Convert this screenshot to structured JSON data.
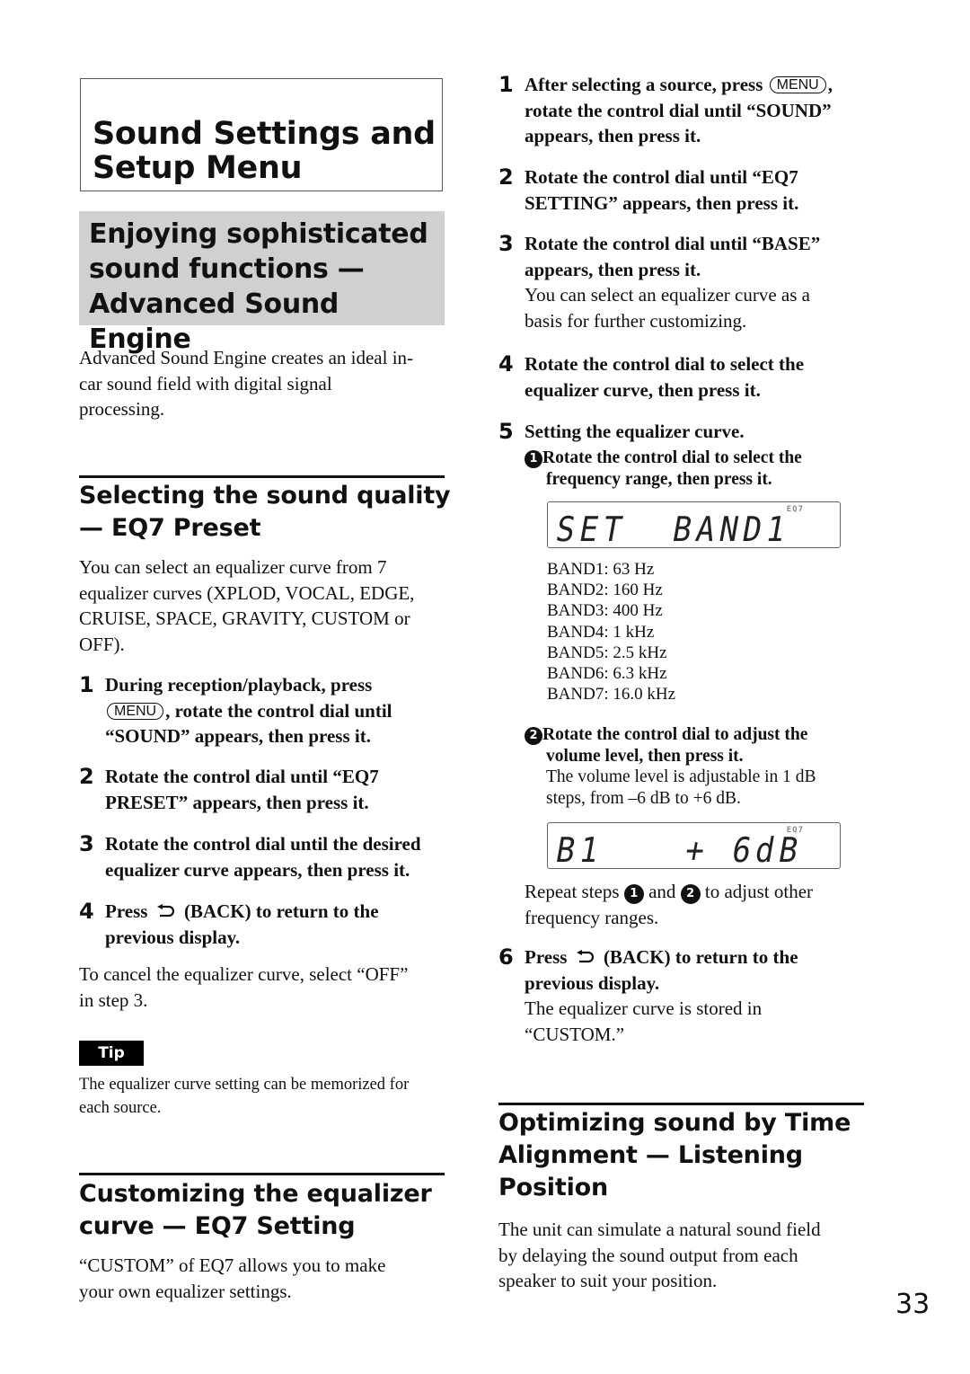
{
  "page_number": "33",
  "chapter": {
    "title_line1": "Sound Settings and",
    "title_line2": "Setup Menu"
  },
  "advanced": {
    "title_line1": "Enjoying sophisticated",
    "title_line2": "sound functions —",
    "title_line3": "Advanced Sound Engine",
    "body_line1": "Advanced Sound Engine creates an ideal in-",
    "body_line2": "car sound field with digital signal",
    "body_line3": "processing."
  },
  "eq_preset": {
    "title_line1": "Selecting the sound quality",
    "title_line2": "— EQ7 Preset",
    "intro_line1": "You can select an equalizer curve from 7",
    "intro_line2": "equalizer curves (XPLOD, VOCAL, EDGE,",
    "intro_line3": "CRUISE, SPACE, GRAVITY, CUSTOM or",
    "intro_line4": "OFF).",
    "steps": [
      {
        "num": "1",
        "l1": "During reception/playback, press",
        "key": "MENU",
        "l2_after_key": ", rotate the control dial until",
        "l3": "“SOUND” appears, then press it."
      },
      {
        "num": "2",
        "l1": "Rotate the control dial until “EQ7",
        "l2": "PRESET” appears, then press it."
      },
      {
        "num": "3",
        "l1": "Rotate the control dial until the desired",
        "l2": "equalizer curve appears, then press it."
      },
      {
        "num": "4",
        "l1_before_icon": "Press",
        "l1_after_icon": "(BACK) to return to the",
        "l2": "previous display."
      }
    ],
    "cancel_line1": "To cancel the equalizer curve, select “OFF”",
    "cancel_line2": "in step 3.",
    "tip_label": "Tip",
    "tip_line1": "The equalizer curve setting can be memorized for",
    "tip_line2": "each source."
  },
  "eq_setting": {
    "title_line1": "Customizing the equalizer",
    "title_line2": "curve — EQ7 Setting",
    "intro_line1": "“CUSTOM” of EQ7 allows you to make",
    "intro_line2": "your own equalizer settings.",
    "steps": [
      {
        "num": "1",
        "l1_before_key": "After selecting a source, press",
        "key": "MENU",
        "l1_after_key": ",",
        "l2": "rotate the control dial until “SOUND”",
        "l3": "appears, then press it."
      },
      {
        "num": "2",
        "l1": "Rotate the control dial until “EQ7",
        "l2": "SETTING” appears, then press it."
      },
      {
        "num": "3",
        "l1": "Rotate the control dial until “BASE”",
        "l2": "appears, then press it.",
        "note1": "You can select an equalizer curve as a",
        "note2": "basis for further customizing."
      },
      {
        "num": "4",
        "l1": "Rotate the control dial to select the",
        "l2": "equalizer curve, then press it."
      },
      {
        "num": "5",
        "l1": "Setting the equalizer curve."
      },
      {
        "num": "6",
        "l1_before_icon": "Press",
        "l1_after_icon": "(BACK) to return to the",
        "l2": "previous display.",
        "note1": "The equalizer curve is stored in",
        "note2": "“CUSTOM.”"
      }
    ],
    "substep1": {
      "marker": "1",
      "l1": "Rotate the control dial to select the",
      "l2": "frequency range, then press it."
    },
    "lcd1": {
      "text": "SET  BAND1",
      "indicator": "EQ7"
    },
    "bands": [
      "BAND1: 63 Hz",
      "BAND2: 160 Hz",
      "BAND3: 400 Hz",
      "BAND4: 1 kHz",
      "BAND5: 2.5 kHz",
      "BAND6: 6.3 kHz",
      "BAND7: 16.0 kHz"
    ],
    "substep2": {
      "marker": "2",
      "l1": "Rotate the control dial to adjust the",
      "l2": "volume level, then press it.",
      "note1": "The volume level is adjustable in 1 dB",
      "note2": "steps, from –6 dB to +6 dB."
    },
    "lcd2": {
      "left": "B1",
      "right": "+ 6dB",
      "indicator": "EQ7"
    },
    "repeat": {
      "before": "Repeat steps",
      "m1": "1",
      "mid": "and",
      "m2": "2",
      "after": "to adjust other",
      "line2": "frequency ranges."
    }
  },
  "time_alignment": {
    "title_line1": "Optimizing sound by Time",
    "title_line2": "Alignment — Listening",
    "title_line3": "Position",
    "body_line1": "The unit can simulate a natural sound field",
    "body_line2": "by delaying the sound output from each",
    "body_line3": "speaker to suit your position."
  }
}
